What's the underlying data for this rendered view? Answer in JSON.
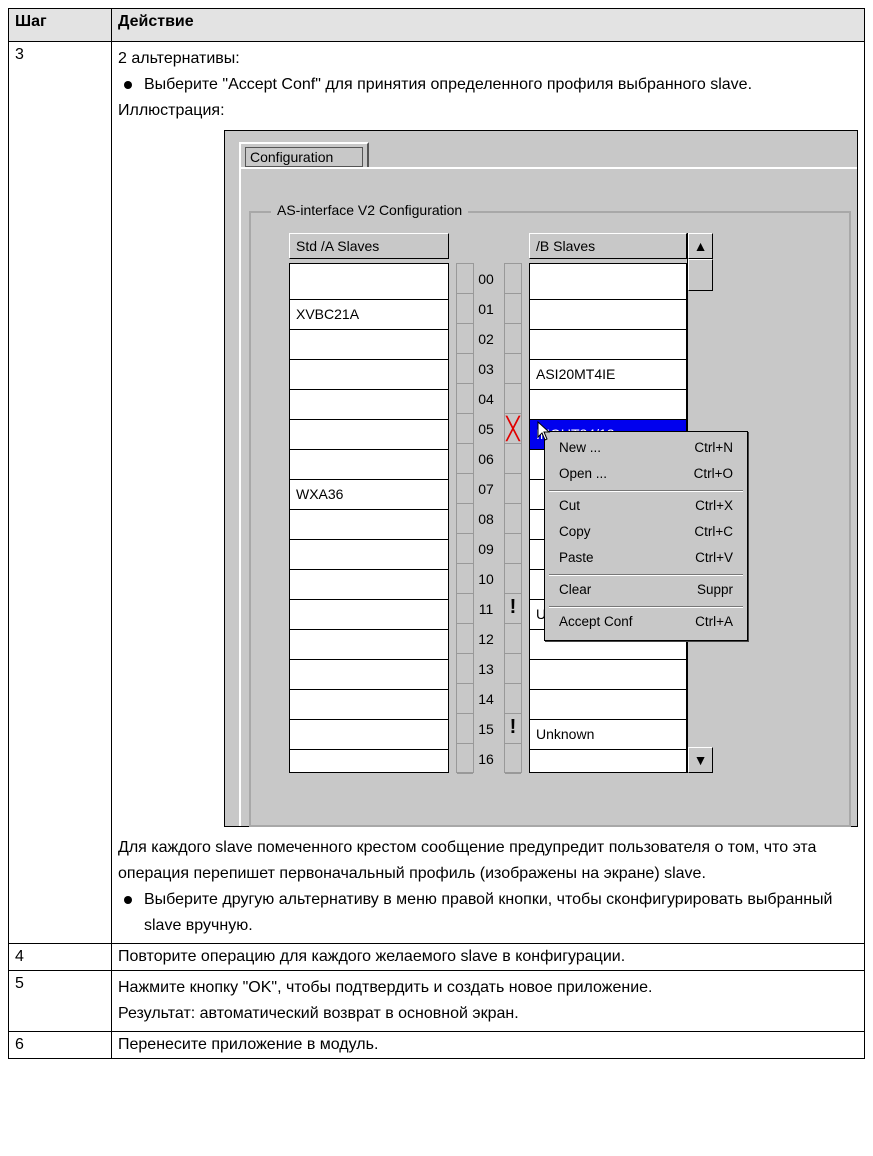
{
  "table": {
    "header": {
      "step": "Шаг",
      "action": "Действие"
    },
    "row3": {
      "step": "3",
      "intro": "2 альтернативы:",
      "bullet1": "Выберите \"Accept Conf\" для принятия определенного профиля выбранного slave.",
      "illustration_label": "Иллюстрация:",
      "para": "Для каждого slave помеченного крестом сообщение предупредит пользователя о том, что эта операция перепишет первоначальный профиль (изображены на экране) slave.",
      "bullet2": "Выберите другую альтернативу в меню правой кнопки, чтобы сконфигурировать выбранный slave вручную."
    },
    "row4": {
      "step": "4",
      "action": "Повторите операцию для каждого желаемого slave в конфигурации."
    },
    "row5": {
      "step": "5",
      "action": "Нажмите кнопку \"OK\", чтобы подтвердить и создать новое приложение.",
      "action2": "Результат: автоматический возврат в основной экран."
    },
    "row6": {
      "step": "6",
      "action": "Перенесите приложение в модуль."
    }
  },
  "illustration": {
    "tab_label": "Configuration",
    "group_title": "AS-interface V2 Configuration",
    "left_header": "Std /A Slaves",
    "right_header": "/B Slaves",
    "numbers": [
      "00",
      "01",
      "02",
      "03",
      "04",
      "05",
      "06",
      "07",
      "08",
      "09",
      "10",
      "11",
      "12",
      "13",
      "14",
      "15",
      "16"
    ],
    "left_slaves": [
      "",
      "XVBC21A",
      "",
      "",
      "",
      "",
      "",
      "WXA36",
      "",
      "",
      "",
      "",
      "",
      "",
      "",
      "",
      ""
    ],
    "right_slaves": [
      "",
      "",
      "",
      "ASI20MT4IE",
      "",
      "INOUT24/12",
      "",
      "",
      "",
      "",
      "",
      "Un",
      "",
      "",
      "",
      "Unknown",
      ""
    ],
    "selected_right_index": 5,
    "marks": {
      "05": "X",
      "11": "!",
      "15": "!"
    },
    "context_menu": [
      {
        "label": "New ...",
        "shortcut": "Ctrl+N"
      },
      {
        "label": "Open ...",
        "shortcut": "Ctrl+O"
      },
      {
        "label": "Cut",
        "shortcut": "Ctrl+X"
      },
      {
        "label": "Copy",
        "shortcut": "Ctrl+C"
      },
      {
        "label": "Paste",
        "shortcut": "Ctrl+V"
      },
      {
        "label": "Clear",
        "shortcut": "Suppr"
      },
      {
        "label": "Accept Conf",
        "shortcut": "Ctrl+A"
      }
    ],
    "colors": {
      "selection": "#0000ee",
      "mark_x": "#e00000",
      "panel": "#c8c8c8"
    }
  }
}
